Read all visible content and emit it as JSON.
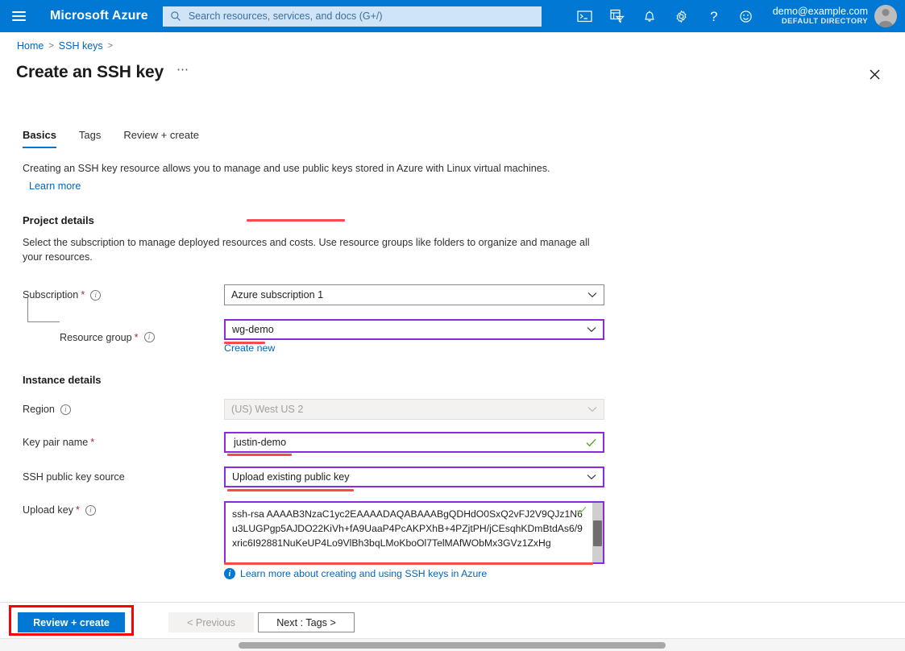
{
  "topbar": {
    "menu_icon": "hamburger-icon",
    "brand": "Microsoft Azure",
    "search_placeholder": "Search resources, services, and docs (G+/)",
    "search_value": "",
    "icons": [
      {
        "name": "cloud-shell-icon",
        "title": "Cloud Shell"
      },
      {
        "name": "directories-subscriptions-icon",
        "title": "Directories + subscriptions"
      },
      {
        "name": "notifications-bell-icon",
        "title": "Notifications"
      },
      {
        "name": "settings-gear-icon",
        "title": "Settings"
      },
      {
        "name": "help-question-icon",
        "title": "Help",
        "glyph": "?"
      },
      {
        "name": "feedback-smiley-icon",
        "title": "Feedback"
      }
    ],
    "account": {
      "email": "demo@example.com",
      "directory": "DEFAULT DIRECTORY"
    }
  },
  "breadcrumb": {
    "items": [
      "Home",
      "SSH keys"
    ],
    "separator": ">"
  },
  "header": {
    "title": "Create an SSH key",
    "more_label": "⋯",
    "close_label": "Close"
  },
  "tabs": [
    {
      "label": "Basics",
      "active": true
    },
    {
      "label": "Tags",
      "active": false
    },
    {
      "label": "Review + create",
      "active": false
    }
  ],
  "intro": {
    "text": "Creating an SSH key resource allows you to manage and use public keys stored in Azure with Linux virtual machines.",
    "learn_more": "Learn more"
  },
  "project_details": {
    "heading": "Project details",
    "description": "Select the subscription to manage deployed resources and costs. Use resource groups like folders to organize and manage all your resources.",
    "subscription": {
      "label": "Subscription",
      "required": "*",
      "value": "Azure subscription 1"
    },
    "resource_group": {
      "label": "Resource group",
      "required": "*",
      "value": "wg-demo",
      "create_new": "Create new"
    }
  },
  "instance_details": {
    "heading": "Instance details",
    "region": {
      "label": "Region",
      "value": "(US) West US 2",
      "disabled": true
    },
    "key_pair_name": {
      "label": "Key pair name",
      "required": "*",
      "value": "justin-demo",
      "valid": true
    },
    "ssh_public_key_source": {
      "label": "SSH public key source",
      "value": "Upload existing public key"
    },
    "upload_key": {
      "label": "Upload key",
      "required": "*",
      "value": "ssh-rsa AAAAB3NzaC1yc2EAAAADAQABAAABgQDHdO0SxQ2vFJ2V9QJz1N6u3LUGPgp5AJDO22KiVh+fA9UaaP4PcAKPXhB+4PZjtPH/jCEsqhKDmBtdAs6/9xric6I92881NuKeUP4Lo9VlBh3bqLMoKboOl7TelMAfWObMx3GVz1ZxHg",
      "valid": true,
      "note": "Learn more about creating and using SSH keys in Azure"
    }
  },
  "footer": {
    "review_create": "Review + create",
    "previous": "< Previous",
    "next": "Next : Tags >"
  },
  "colors": {
    "azure_blue": "#0078d4",
    "focus_purple": "#8a2be2",
    "annotation_red": "#fb4a4a",
    "highlight_red": "#ff0000",
    "valid_green": "#5b9e2d",
    "link_blue": "#0066c0"
  }
}
